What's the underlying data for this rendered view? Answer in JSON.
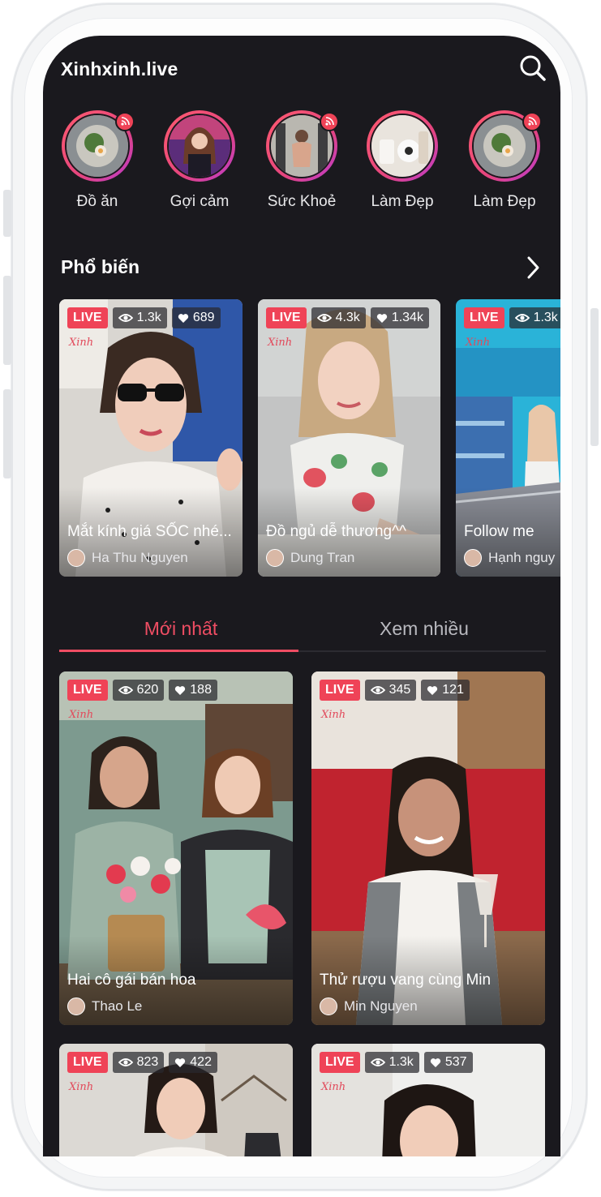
{
  "app": {
    "title": "Xinhxinh.live"
  },
  "categories": [
    {
      "label": "Đồ ăn",
      "live": true
    },
    {
      "label": "Gợi cảm",
      "live": false
    },
    {
      "label": "Sức Khoẻ",
      "live": true
    },
    {
      "label": "Làm Đẹp",
      "live": false
    },
    {
      "label": "Làm Đẹp",
      "live": true
    }
  ],
  "popular": {
    "title": "Phổ biến",
    "cards": [
      {
        "live": "LIVE",
        "views": "1.3k",
        "likes": "689",
        "title": "Mắt kính giá SỐC nhé...",
        "author": "Ha Thu Nguyen"
      },
      {
        "live": "LIVE",
        "views": "4.3k",
        "likes": "1.34k",
        "title": "Đồ ngủ dễ thương^^",
        "author": "Dung Tran"
      },
      {
        "live": "LIVE",
        "views": "1.3k",
        "likes": "",
        "title": "Follow me",
        "author": "Hạnh nguy"
      }
    ]
  },
  "tabs": [
    {
      "label": "Mới nhất",
      "active": true
    },
    {
      "label": "Xem nhiều",
      "active": false
    }
  ],
  "feed": {
    "cards": [
      {
        "live": "LIVE",
        "views": "620",
        "likes": "188",
        "title": "Hai cô gái bán hoa",
        "author": "Thao Le"
      },
      {
        "live": "LIVE",
        "views": "345",
        "likes": "121",
        "title": "Thử rượu vang cùng Min",
        "author": "Min Nguyen"
      },
      {
        "live": "LIVE",
        "views": "823",
        "likes": "422",
        "title": "",
        "author": ""
      },
      {
        "live": "LIVE",
        "views": "1.3k",
        "likes": "537",
        "title": "",
        "author": ""
      }
    ]
  },
  "watermark": "Xinh",
  "colors": {
    "accent": "#ef4d63",
    "live_badge": "#ef4357",
    "screen_bg": "#1a191e"
  },
  "icons": [
    "search-icon",
    "chevron-right-icon",
    "broadcast-icon",
    "eye-icon",
    "heart-icon"
  ]
}
